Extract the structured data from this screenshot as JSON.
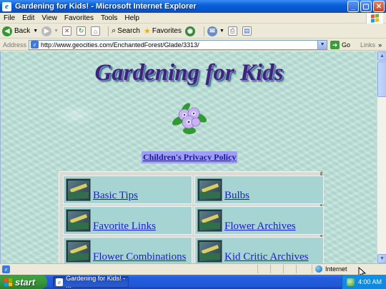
{
  "window": {
    "title": "Gardening for Kids! - Microsoft Internet Explorer",
    "minimize": "_",
    "maximize": "▢",
    "close": "✕"
  },
  "menu": [
    "File",
    "Edit",
    "View",
    "Favorites",
    "Tools",
    "Help"
  ],
  "toolbar": {
    "back": "Back",
    "search": "Search",
    "favorites": "Favorites"
  },
  "address": {
    "label": "Address",
    "url": "http://www.geocities.com/EnchantedForest/Glade/3313/",
    "go": "Go",
    "links": "Links",
    "chevron": "»"
  },
  "page": {
    "heading": "Gardening for Kids",
    "privacy_link": "Children's Privacy Policy",
    "nav": [
      {
        "label": "Basic Tips"
      },
      {
        "label": "Bulbs"
      },
      {
        "label": "Favorite Links"
      },
      {
        "label": "Flower Archives"
      },
      {
        "label": "Flower Combinations"
      },
      {
        "label": "Kid Critic Archives"
      }
    ]
  },
  "status": {
    "zone": "Internet"
  },
  "taskbar": {
    "start": "start",
    "task": "Gardening for Kids! - ...",
    "clock": "4:00 AM"
  },
  "colors": {
    "title_blue": "#0653c9",
    "page_background": "#bde0d6",
    "link": "#1a1ae0",
    "nav_cell": "#a6d4d2",
    "privacy_highlight": "#9f9ff2",
    "heading": "#3e2480"
  }
}
